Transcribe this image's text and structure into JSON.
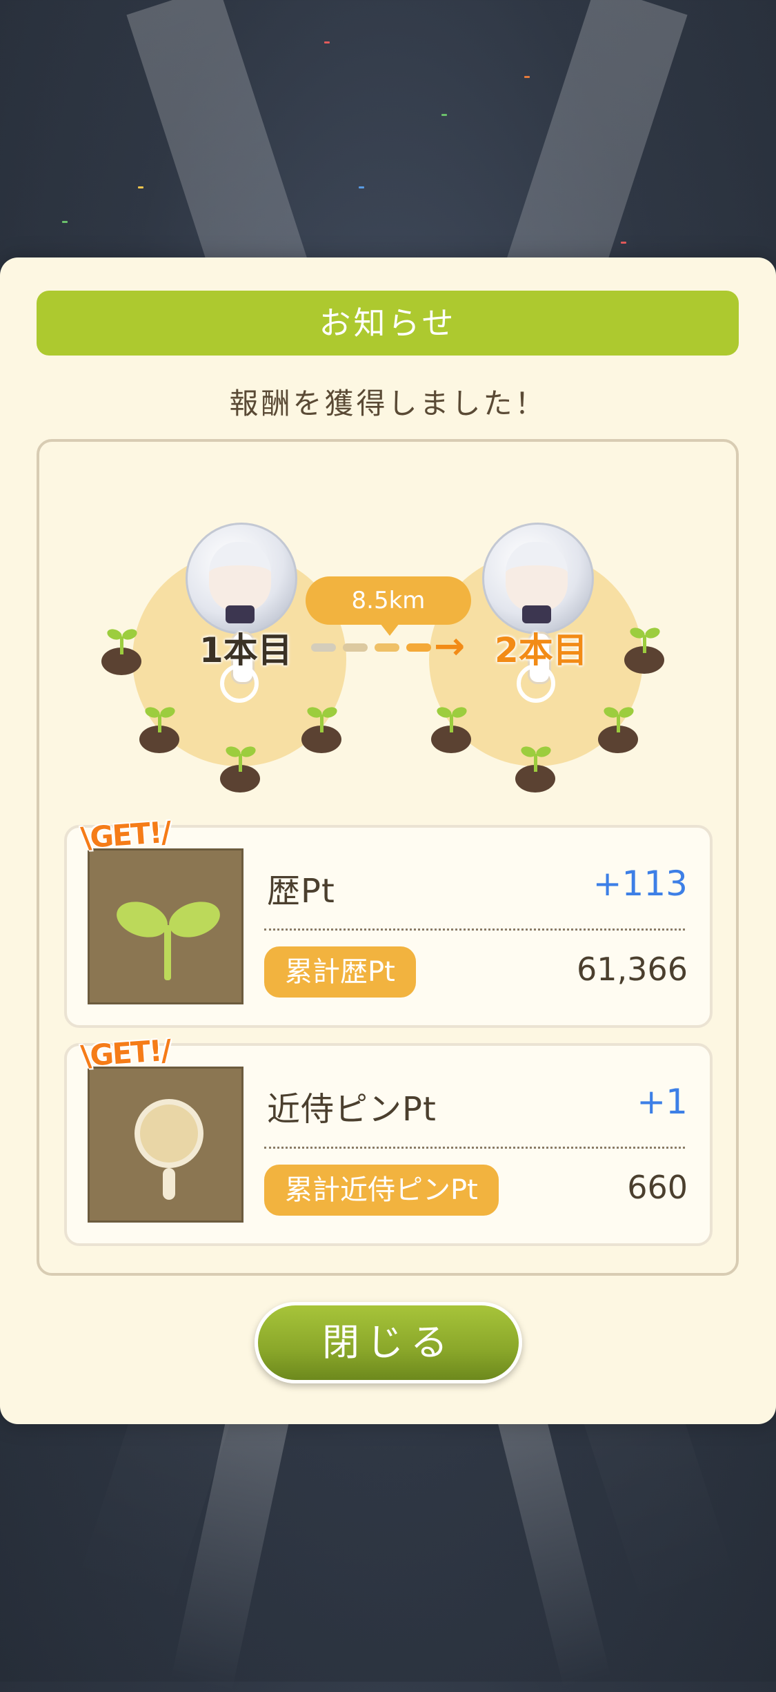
{
  "dialog": {
    "title": "お知らせ",
    "subtitle": "報酬を獲得しました！",
    "close_label": "閉じる"
  },
  "map": {
    "distance": "8.5km",
    "from_label": "1本目",
    "to_label": "2本目"
  },
  "rewards": [
    {
      "badge": "\\GET!/",
      "name": "歴Pt",
      "gain": "+113",
      "total_label": "累計歴Pt",
      "total_value": "61,366",
      "icon": "seedling-icon"
    },
    {
      "badge": "\\GET!/",
      "name": "近侍ピンPt",
      "gain": "+1",
      "total_label": "累計近侍ピンPt",
      "total_value": "660",
      "icon": "magnifier-pin-icon"
    }
  ],
  "colors": {
    "title_bar": "#adc92f",
    "accent_orange": "#f2b33f",
    "gain_blue": "#3d7fe6",
    "close_button": "#8aa72a"
  }
}
